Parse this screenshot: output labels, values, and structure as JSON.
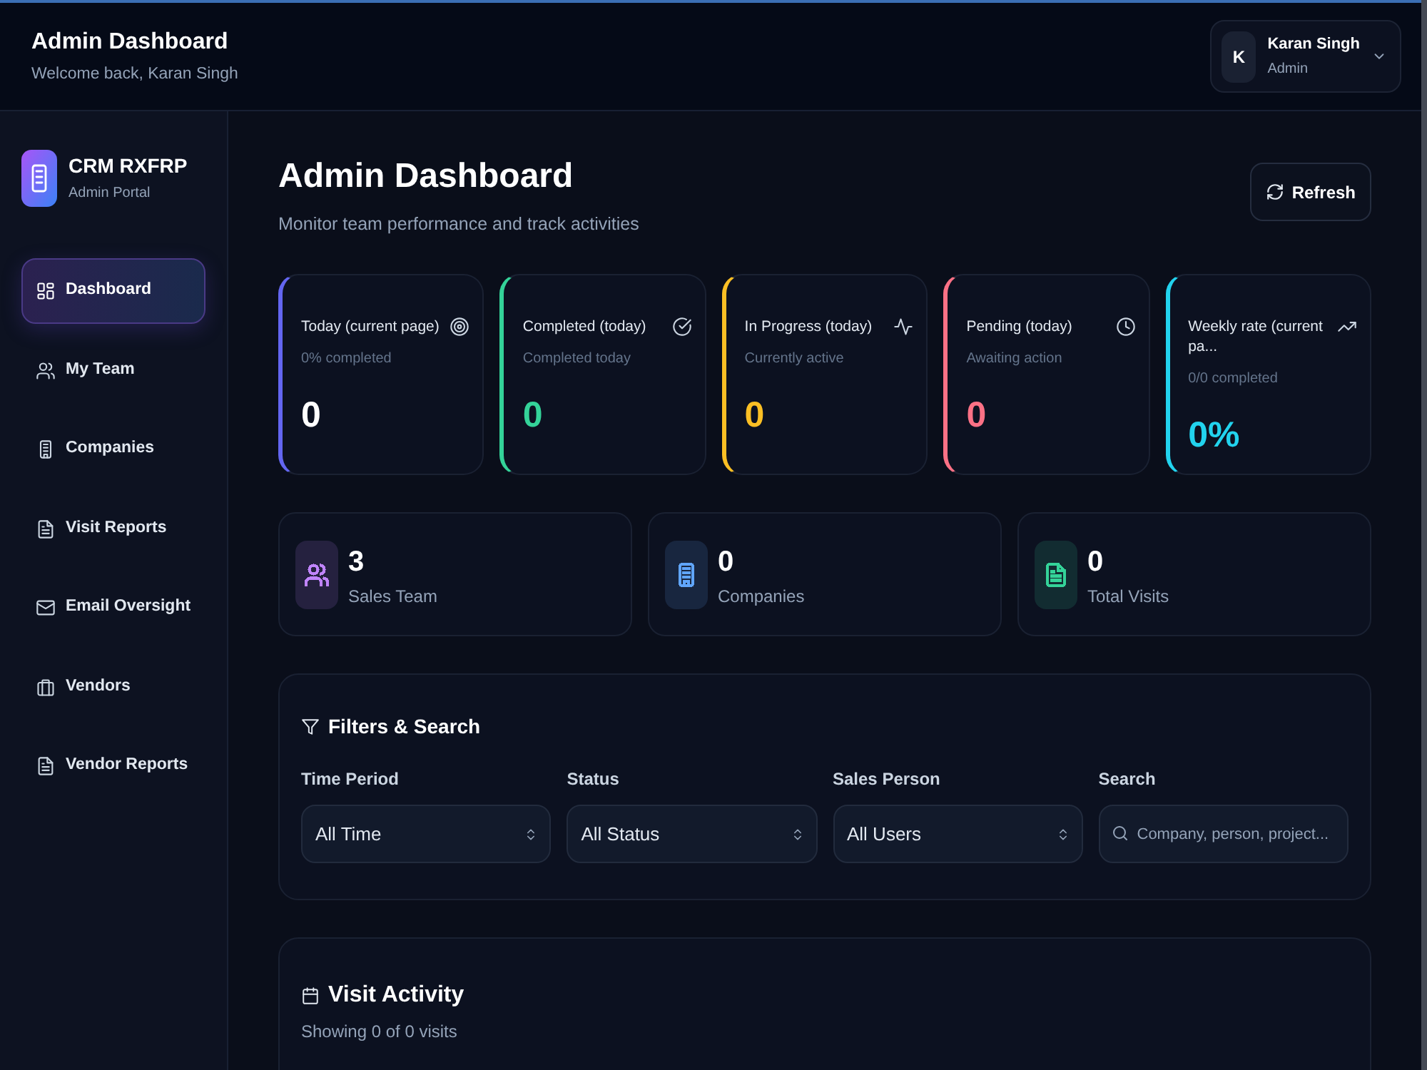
{
  "top_bar": {
    "title": "Admin Dashboard",
    "subtitle": "Welcome back, Karan Singh",
    "user": {
      "initial": "K",
      "name": "Karan Singh",
      "role": "Admin"
    }
  },
  "sidebar": {
    "brand": {
      "name": "CRM RXFRP",
      "subtitle": "Admin Portal"
    },
    "items": [
      {
        "label": "Dashboard",
        "kind": "grid",
        "selected": true
      },
      {
        "label": "My Team",
        "kind": "users",
        "selected": false
      },
      {
        "label": "Companies",
        "kind": "building",
        "selected": false
      },
      {
        "label": "Visit Reports",
        "kind": "document",
        "selected": false
      },
      {
        "label": "Email Oversight",
        "kind": "mail",
        "selected": false
      },
      {
        "label": "Vendors",
        "kind": "briefcase",
        "selected": false
      },
      {
        "label": "Vendor Reports",
        "kind": "document",
        "selected": false
      }
    ]
  },
  "page": {
    "title": "Admin Dashboard",
    "subtitle": "Monitor team performance and track activities",
    "refresh_button": "Refresh"
  },
  "stats": [
    {
      "title": "Today (current page)",
      "subtitle": "0% completed",
      "value": "0",
      "kind": "target",
      "color": "#6366f1"
    },
    {
      "title": "Completed (today)",
      "subtitle": "Completed today",
      "value": "0",
      "kind": "check",
      "color": "#34d399"
    },
    {
      "title": "In Progress (today)",
      "subtitle": "Currently active",
      "value": "0",
      "kind": "activity",
      "color": "#fbbf24"
    },
    {
      "title": "Pending (today)",
      "subtitle": "Awaiting action",
      "value": "0",
      "kind": "clock",
      "color": "#fb7185"
    },
    {
      "title": "Weekly rate (current pa...",
      "subtitle": "0/0 completed",
      "value": "0%",
      "kind": "trend",
      "color": "#22d3ee"
    }
  ],
  "summary": [
    {
      "value": "3",
      "label": "Sales Team",
      "kind": "users",
      "color": "#c084fc"
    },
    {
      "value": "0",
      "label": "Companies",
      "kind": "building",
      "color": "#60a5fa"
    },
    {
      "value": "0",
      "label": "Total Visits",
      "kind": "document",
      "color": "#34d399"
    }
  ],
  "filters": {
    "title": "Filters & Search",
    "fields": [
      {
        "kind": "select",
        "label": "Time Period",
        "value": "All Time"
      },
      {
        "kind": "select",
        "label": "Status",
        "value": "All Status"
      },
      {
        "kind": "select",
        "label": "Sales Person",
        "value": "All Users"
      },
      {
        "kind": "search",
        "label": "Search",
        "placeholder": "Company, person, project..."
      }
    ]
  },
  "visit_activity": {
    "title": "Visit Activity",
    "summary": "Showing 0 of 0 visits"
  }
}
